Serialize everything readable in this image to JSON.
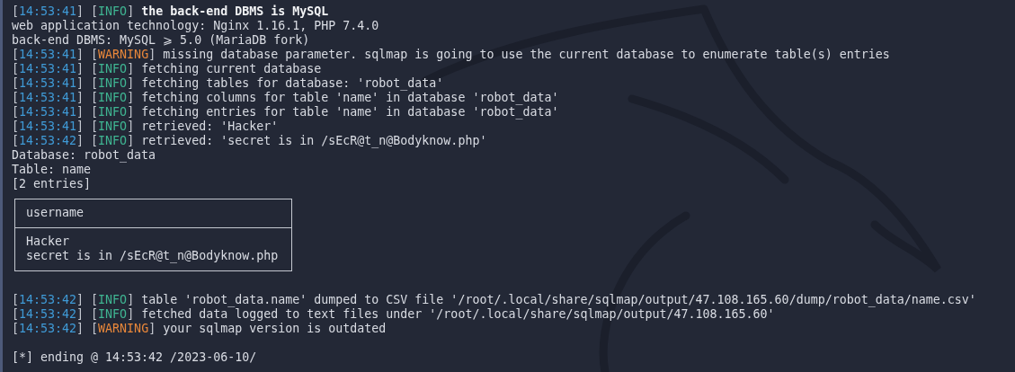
{
  "lines": [
    {
      "kind": "log",
      "time": "[14:53:41]",
      "tag": "[INFO]",
      "color": "#3fb592",
      "bold": true,
      "message": "the back-end DBMS is MySQL"
    },
    {
      "kind": "plain",
      "text": "web application technology: Nginx 1.16.1, PHP 7.4.0"
    },
    {
      "kind": "plain",
      "text": "back-end DBMS: MySQL ⩾ 5.0 (MariaDB fork)"
    },
    {
      "kind": "log",
      "time": "[14:53:41]",
      "tag": "[WARNING]",
      "color": "#e8873a",
      "bold": false,
      "message": "missing database parameter. sqlmap is going to use the current database to enumerate table(s) entries"
    },
    {
      "kind": "log",
      "time": "[14:53:41]",
      "tag": "[INFO]",
      "color": "#3fb592",
      "bold": false,
      "message": "fetching current database"
    },
    {
      "kind": "log",
      "time": "[14:53:41]",
      "tag": "[INFO]",
      "color": "#3fb592",
      "bold": false,
      "message": "fetching tables for database: 'robot_data'"
    },
    {
      "kind": "log",
      "time": "[14:53:41]",
      "tag": "[INFO]",
      "color": "#3fb592",
      "bold": false,
      "message": "fetching columns for table 'name' in database 'robot_data'"
    },
    {
      "kind": "log",
      "time": "[14:53:41]",
      "tag": "[INFO]",
      "color": "#3fb592",
      "bold": false,
      "message": "fetching entries for table 'name' in database 'robot_data'"
    },
    {
      "kind": "log",
      "time": "[14:53:41]",
      "tag": "[INFO]",
      "color": "#3fb592",
      "bold": false,
      "message": "retrieved: 'Hacker'"
    },
    {
      "kind": "log",
      "time": "[14:53:42]",
      "tag": "[INFO]",
      "color": "#3fb592",
      "bold": false,
      "message": "retrieved: 'secret is in /sEcR@t_n@Bodyknow.php'"
    },
    {
      "kind": "plain",
      "text": "Database: robot_data"
    },
    {
      "kind": "plain",
      "text": "Table: name"
    },
    {
      "kind": "plain",
      "text": "[2 entries]"
    },
    {
      "kind": "table",
      "header": "username",
      "rows": [
        "Hacker",
        "secret is in /sEcR@t_n@Bodyknow.php"
      ]
    },
    {
      "kind": "blank"
    },
    {
      "kind": "log",
      "time": "[14:53:42]",
      "tag": "[INFO]",
      "color": "#3fb592",
      "bold": false,
      "message": "table 'robot_data.name' dumped to CSV file '/root/.local/share/sqlmap/output/47.108.165.60/dump/robot_data/name.csv'"
    },
    {
      "kind": "log",
      "time": "[14:53:42]",
      "tag": "[INFO]",
      "color": "#3fb592",
      "bold": false,
      "message": "fetched data logged to text files under '/root/.local/share/sqlmap/output/47.108.165.60'"
    },
    {
      "kind": "log",
      "time": "[14:53:42]",
      "tag": "[WARNING]",
      "color": "#e8873a",
      "bold": false,
      "message": "your sqlmap version is outdated"
    },
    {
      "kind": "blank"
    },
    {
      "kind": "plain",
      "text": "[*] ending @ 14:53:42 /2023-06-10/"
    }
  ]
}
